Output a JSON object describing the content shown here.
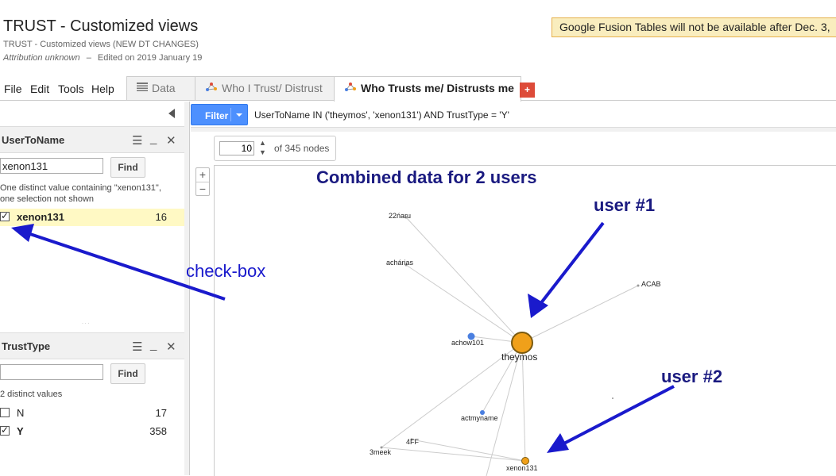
{
  "header": {
    "title": "TRUST - Customized views",
    "subtitle": "TRUST - Customized views (NEW DT CHANGES)",
    "attribution": "Attribution unknown",
    "separator": "–",
    "edited": "Edited on 2019 January 19",
    "banner": "Google Fusion Tables will not be available after Dec. 3,"
  },
  "menu": [
    "File",
    "Edit",
    "Tools",
    "Help"
  ],
  "tabs": [
    {
      "label": "Data",
      "icon": "table-icon",
      "active": false
    },
    {
      "label": "Who I Trust/ Distrust",
      "icon": "network-icon",
      "active": false
    },
    {
      "label": "Who Trusts me/ Distrusts me",
      "icon": "network-icon",
      "active": true
    }
  ],
  "add_tab_label": "+",
  "filters": [
    {
      "title": "UserToName",
      "input_value": "xenon131",
      "find_label": "Find",
      "note": "One distinct value containing \"xenon131\", one selection not shown",
      "rows": [
        {
          "label": "xenon131",
          "count": "16",
          "checked": true
        }
      ]
    },
    {
      "title": "TrustType",
      "input_value": "",
      "find_label": "Find",
      "note": "2 distinct values",
      "rows": [
        {
          "label": "N",
          "count": "17",
          "checked": false
        },
        {
          "label": "Y",
          "count": "358",
          "checked": true
        }
      ]
    }
  ],
  "filterbar": {
    "button_label": "Filter",
    "query": "UserToName IN ('theymos', 'xenon131') AND TrustType = 'Y'"
  },
  "pager": {
    "value": "10",
    "of_text": "of 345 nodes"
  },
  "graph": {
    "annotation_title": "Combined data for 2 users",
    "user1_label": "user #1",
    "user2_label": "user #2",
    "checkbox_label": "check-box",
    "nodes": [
      {
        "id": "22naru",
        "label": "22ńaru",
        "kind": "plain"
      },
      {
        "id": "acharias",
        "label": "achárias",
        "kind": "plain"
      },
      {
        "id": "ACAB",
        "label": "ACAB",
        "kind": "plain"
      },
      {
        "id": "achow101",
        "label": "achow101",
        "kind": "blue"
      },
      {
        "id": "theymos",
        "label": "theymos",
        "kind": "main"
      },
      {
        "id": "actmyname",
        "label": "actmyname",
        "kind": "blue-small"
      },
      {
        "id": "4FF",
        "label": "4FF",
        "kind": "plain"
      },
      {
        "id": "3meek",
        "label": "3meek",
        "kind": "plain"
      },
      {
        "id": "xenon131",
        "label": "xenon131",
        "kind": "orange-small"
      }
    ],
    "edges": [
      [
        "22naru",
        "theymos"
      ],
      [
        "acharias",
        "theymos"
      ],
      [
        "ACAB",
        "theymos"
      ],
      [
        "achow101",
        "theymos"
      ],
      [
        "theymos",
        "xenon131"
      ],
      [
        "actmyname",
        "theymos"
      ],
      [
        "3meek",
        "theymos"
      ],
      [
        "3meek",
        "xenon131"
      ],
      [
        "4FF",
        "xenon131"
      ]
    ],
    "colors": {
      "main_node": "#f0a01a",
      "blue_node": "#4a7fe0",
      "orange_node": "#f0a01a",
      "arrow": "#1a1acc",
      "annotation": "#1a1a80",
      "edge": "#cccccc"
    }
  }
}
